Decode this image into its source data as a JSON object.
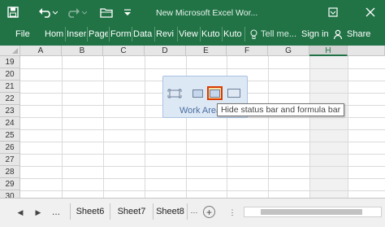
{
  "titlebar": {
    "title": "New Microsoft Excel Wor...",
    "restore_icon": "restore-window-icon",
    "close_icon": "close-icon"
  },
  "ribbon": {
    "tabs": [
      "File",
      "Hom",
      "Inser",
      "Page",
      "Form",
      "Data",
      "Revi",
      "View",
      "Kuto",
      "Kuto"
    ],
    "tell_me": "Tell me...",
    "sign_in": "Sign in",
    "share": "Share"
  },
  "grid": {
    "columns": [
      "A",
      "B",
      "C",
      "D",
      "E",
      "F",
      "G",
      "H"
    ],
    "active_column": "H",
    "rows": [
      "19",
      "20",
      "21",
      "22",
      "23",
      "24",
      "25",
      "26",
      "27",
      "28",
      "29",
      "30"
    ]
  },
  "popup": {
    "label": "Work Area",
    "buttons": [
      "full-screen",
      "hide-ribbon",
      "hide-status-and-formula-bar",
      "normal-view"
    ],
    "selected": "hide-status-and-formula-bar"
  },
  "tooltip": {
    "text": "Hide status bar and formula bar"
  },
  "sheets": {
    "ellipsis": "...",
    "tabs": [
      "Sheet6",
      "Sheet7",
      "Sheet8"
    ],
    "add_label": "+"
  },
  "colors": {
    "brand": "#217346",
    "popup_bg": "#dde8f5",
    "selected_border": "#d83b01"
  }
}
